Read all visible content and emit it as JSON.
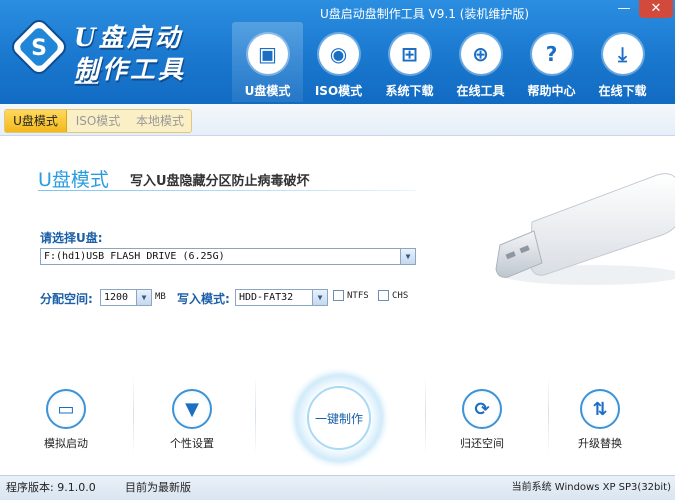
{
  "window": {
    "title": "U盘启动盘制作工具 V9.1 (装机维护版)",
    "min_label": "—",
    "close_label": "✕"
  },
  "logo": {
    "line1": "U盘启动盘",
    "line2": "制作工具",
    "mark": "S"
  },
  "nav": [
    {
      "label": "U盘模式",
      "icon": "usb-drive-icon",
      "glyph": "▣",
      "active": true
    },
    {
      "label": "ISO模式",
      "icon": "disc-icon",
      "glyph": "◉",
      "active": false
    },
    {
      "label": "系统下载",
      "icon": "windows-logo-icon",
      "glyph": "⊞",
      "active": false
    },
    {
      "label": "在线工具",
      "icon": "globe-icon",
      "glyph": "⊕",
      "active": false
    },
    {
      "label": "帮助中心",
      "icon": "question-icon",
      "glyph": "?",
      "active": false
    },
    {
      "label": "在线下载",
      "icon": "download-icon",
      "glyph": "⤓",
      "active": false
    }
  ],
  "tabs": [
    {
      "label": "U盘模式",
      "active": true
    },
    {
      "label": "ISO模式",
      "active": false
    },
    {
      "label": "本地模式",
      "active": false
    }
  ],
  "main": {
    "mode_title": "U盘模式",
    "mode_subtitle": "写入U盘隐藏分区防止病毒破坏",
    "udisk_label": "请选择U盘:",
    "udisk_value": "F:(hd1)USB FLASH DRIVE (6.25G)",
    "alloc_label": "分配空间:",
    "alloc_value": "1200",
    "alloc_unit": "MB",
    "write_label": "写入模式:",
    "write_value": "HDD-FAT32",
    "ntfs_label": "NTFS",
    "chs_label": "CHS"
  },
  "tools": {
    "simulate": {
      "label": "模拟启动",
      "glyph": "▭"
    },
    "custom": {
      "label": "个性设置",
      "glyph": "▼"
    },
    "oneclick": {
      "label": "一键制作"
    },
    "restore": {
      "label": "归还空间",
      "glyph": "⟳"
    },
    "upgrade": {
      "label": "升级替换",
      "glyph": "⇅"
    }
  },
  "status": {
    "version": "程序版本: 9.1.0.0",
    "latest": "目前为最新版",
    "os": "当前系统 Windows XP SP3(32bit)"
  },
  "colors": {
    "header": "#1a78cf",
    "accent": "#2a9de0",
    "tab_active": "#f3b91c"
  }
}
